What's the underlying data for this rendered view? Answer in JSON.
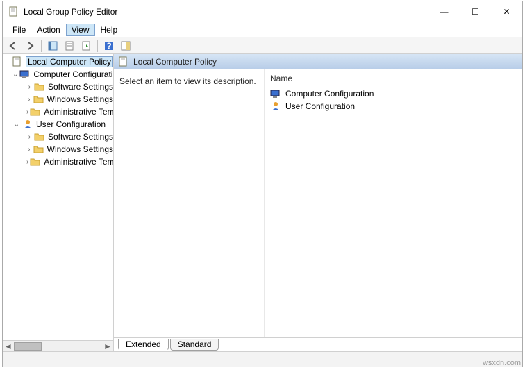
{
  "title": "Local Group Policy Editor",
  "window_controls": {
    "min": "—",
    "max": "☐",
    "close": "✕"
  },
  "menu": [
    "File",
    "Action",
    "View",
    "Help"
  ],
  "menu_selected_index": 2,
  "root": "Local Computer Policy",
  "tree": {
    "computer": {
      "label": "Computer Configuration",
      "children": [
        "Software Settings",
        "Windows Settings",
        "Administrative Templates"
      ]
    },
    "user": {
      "label": "User Configuration",
      "children": [
        "Software Settings",
        "Windows Settings",
        "Administrative Templates"
      ]
    }
  },
  "content": {
    "header": "Local Computer Policy",
    "description": "Select an item to view its description.",
    "column_name": "Name",
    "items": [
      "Computer Configuration",
      "User Configuration"
    ]
  },
  "tabs": [
    "Extended",
    "Standard"
  ],
  "watermark": "wsxdn.com"
}
